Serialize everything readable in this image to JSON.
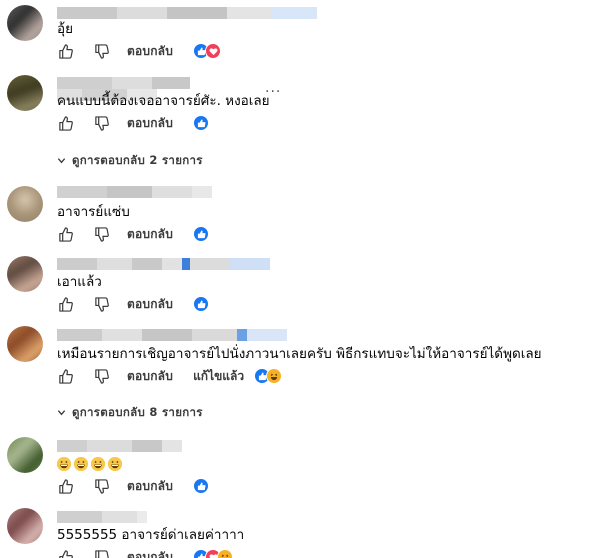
{
  "comments": [
    {
      "text": "อุ้ย",
      "reply_label": "ตอบกลับ",
      "reactions": [
        "like-icon",
        "love-icon"
      ]
    },
    {
      "text": "คนแบบนี้ต้องเจออาจารย์ศัะ. หงอเลย",
      "reply_label": "ตอบกลับ",
      "reactions": [
        "like-icon"
      ],
      "more_label": "···"
    },
    {
      "text": "อาจารย์แซ่บ",
      "reply_label": "ตอบกลับ",
      "reactions": [
        "like-icon"
      ]
    },
    {
      "text": "เอาแล้ว",
      "reply_label": "ตอบกลับ",
      "reactions": [
        "like-icon"
      ]
    },
    {
      "text": "เหมือนรายการเชิญอาจารย์ไปนั่งภาวนาเลยครับ พิธีกรแทบจะไม่ให้อาจารย์ได้พูดเลย",
      "reply_label": "ตอบกลับ",
      "edited_label": "แก้ไขแล้ว",
      "reactions": [
        "like-icon",
        "haha-icon"
      ]
    },
    {
      "text_suffix": "",
      "reply_label": "ตอบกลับ",
      "reactions": [
        "like-icon"
      ]
    },
    {
      "text": "5555555 อาจารย์ด่าเลยค่าาาา",
      "reply_label": "ตอบกลับ",
      "reactions": [
        "like-icon",
        "love-icon",
        "haha-icon"
      ]
    }
  ],
  "view_replies": [
    {
      "label": "ดูการตอบกลับ 2 รายการ"
    },
    {
      "label": "ดูการตอบกลับ 8 รายการ"
    }
  ],
  "colors": {
    "like": "#1877f2",
    "love": "#f33e58",
    "haha": "#f7b125",
    "text_secondary": "#65676b"
  }
}
